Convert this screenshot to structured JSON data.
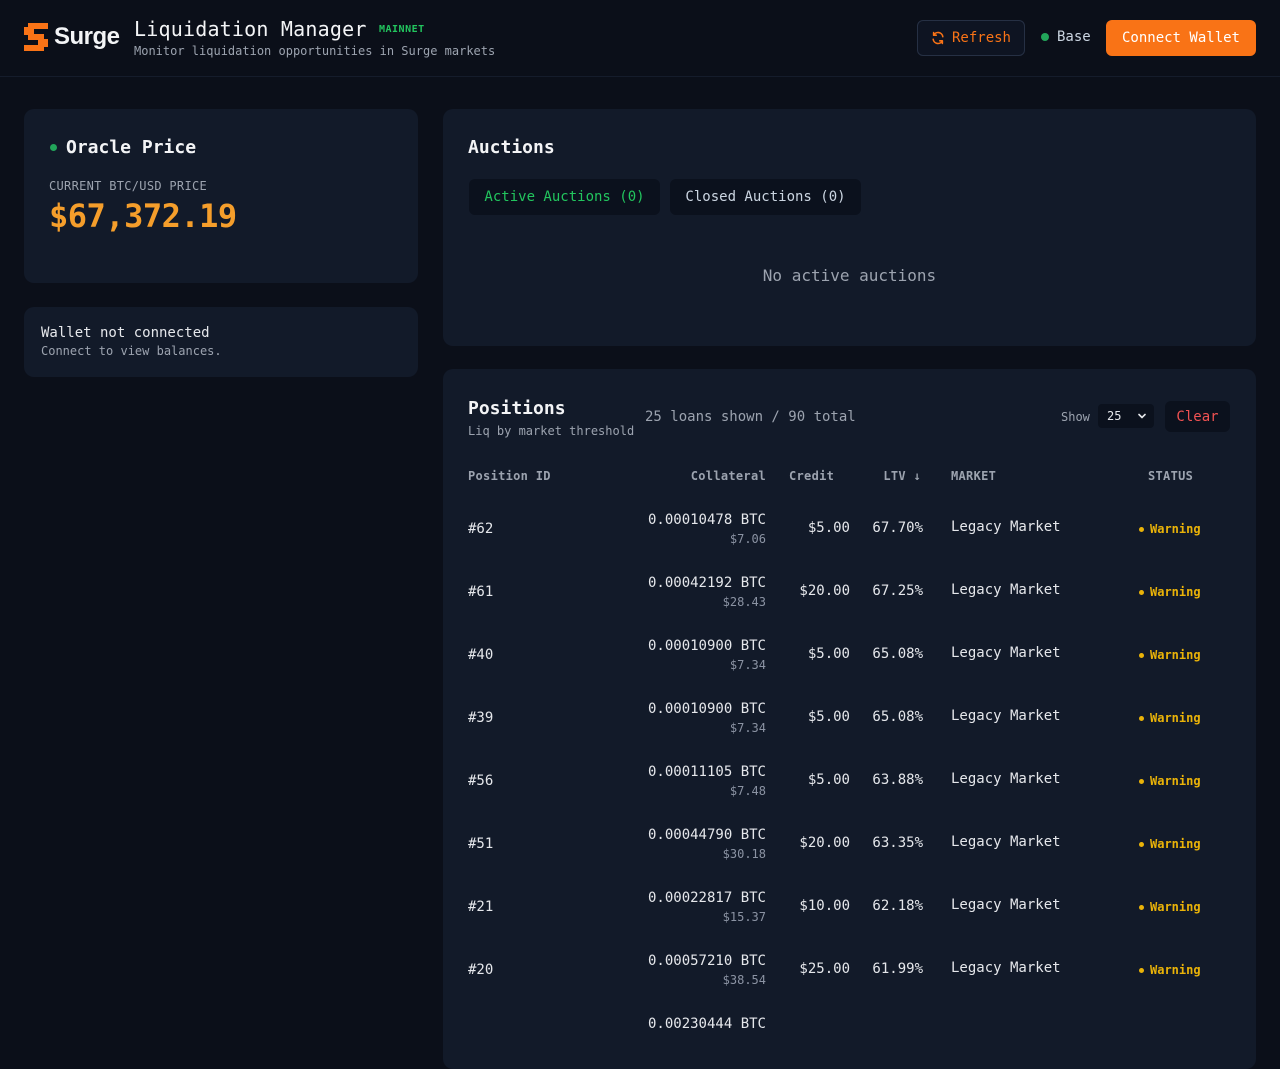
{
  "header": {
    "logo_text": "Surge",
    "title": "Liquidation Manager",
    "network_badge": "MAINNET",
    "subtitle": "Monitor liquidation opportunities in Surge markets",
    "refresh_label": "Refresh",
    "network_name": "Base",
    "connect_label": "Connect Wallet"
  },
  "oracle": {
    "title": "Oracle Price",
    "label": "CURRENT BTC/USD PRICE",
    "price": "$67,372.19"
  },
  "wallet": {
    "title": "Wallet not connected",
    "subtitle": "Connect to view balances."
  },
  "auctions": {
    "title": "Auctions",
    "tabs": [
      {
        "label": "Active Auctions (0)"
      },
      {
        "label": "Closed Auctions (0)"
      }
    ],
    "empty_text": "No active auctions"
  },
  "positions": {
    "title": "Positions",
    "subtitle": "Liq by market threshold",
    "count_text": "25 loans shown / 90 total",
    "show_label": "Show",
    "show_value": "25",
    "clear_label": "Clear",
    "columns": {
      "id": "Position ID",
      "collateral": "Collateral",
      "credit": "Credit",
      "ltv": "LTV ↓",
      "market": "MARKET",
      "status": "STATUS"
    },
    "rows": [
      {
        "id": "#62",
        "collateral": "0.00010478 BTC",
        "collateral_usd": "$7.06",
        "credit": "$5.00",
        "ltv": "67.70%",
        "market": "Legacy Market",
        "status": "Warning"
      },
      {
        "id": "#61",
        "collateral": "0.00042192 BTC",
        "collateral_usd": "$28.43",
        "credit": "$20.00",
        "ltv": "67.25%",
        "market": "Legacy Market",
        "status": "Warning"
      },
      {
        "id": "#40",
        "collateral": "0.00010900 BTC",
        "collateral_usd": "$7.34",
        "credit": "$5.00",
        "ltv": "65.08%",
        "market": "Legacy Market",
        "status": "Warning"
      },
      {
        "id": "#39",
        "collateral": "0.00010900 BTC",
        "collateral_usd": "$7.34",
        "credit": "$5.00",
        "ltv": "65.08%",
        "market": "Legacy Market",
        "status": "Warning"
      },
      {
        "id": "#56",
        "collateral": "0.00011105 BTC",
        "collateral_usd": "$7.48",
        "credit": "$5.00",
        "ltv": "63.88%",
        "market": "Legacy Market",
        "status": "Warning"
      },
      {
        "id": "#51",
        "collateral": "0.00044790 BTC",
        "collateral_usd": "$30.18",
        "credit": "$20.00",
        "ltv": "63.35%",
        "market": "Legacy Market",
        "status": "Warning"
      },
      {
        "id": "#21",
        "collateral": "0.00022817 BTC",
        "collateral_usd": "$15.37",
        "credit": "$10.00",
        "ltv": "62.18%",
        "market": "Legacy Market",
        "status": "Warning"
      },
      {
        "id": "#20",
        "collateral": "0.00057210 BTC",
        "collateral_usd": "$38.54",
        "credit": "$25.00",
        "ltv": "61.99%",
        "market": "Legacy Market",
        "status": "Warning"
      },
      {
        "id": "",
        "collateral": "0.00230444 BTC",
        "collateral_usd": "",
        "credit": "",
        "ltv": "",
        "market": "",
        "status": ""
      }
    ]
  },
  "colors": {
    "accent": "#f97316",
    "price": "#f59e2b",
    "success": "#22c55e",
    "warning": "#eab308",
    "danger": "#f05252"
  }
}
